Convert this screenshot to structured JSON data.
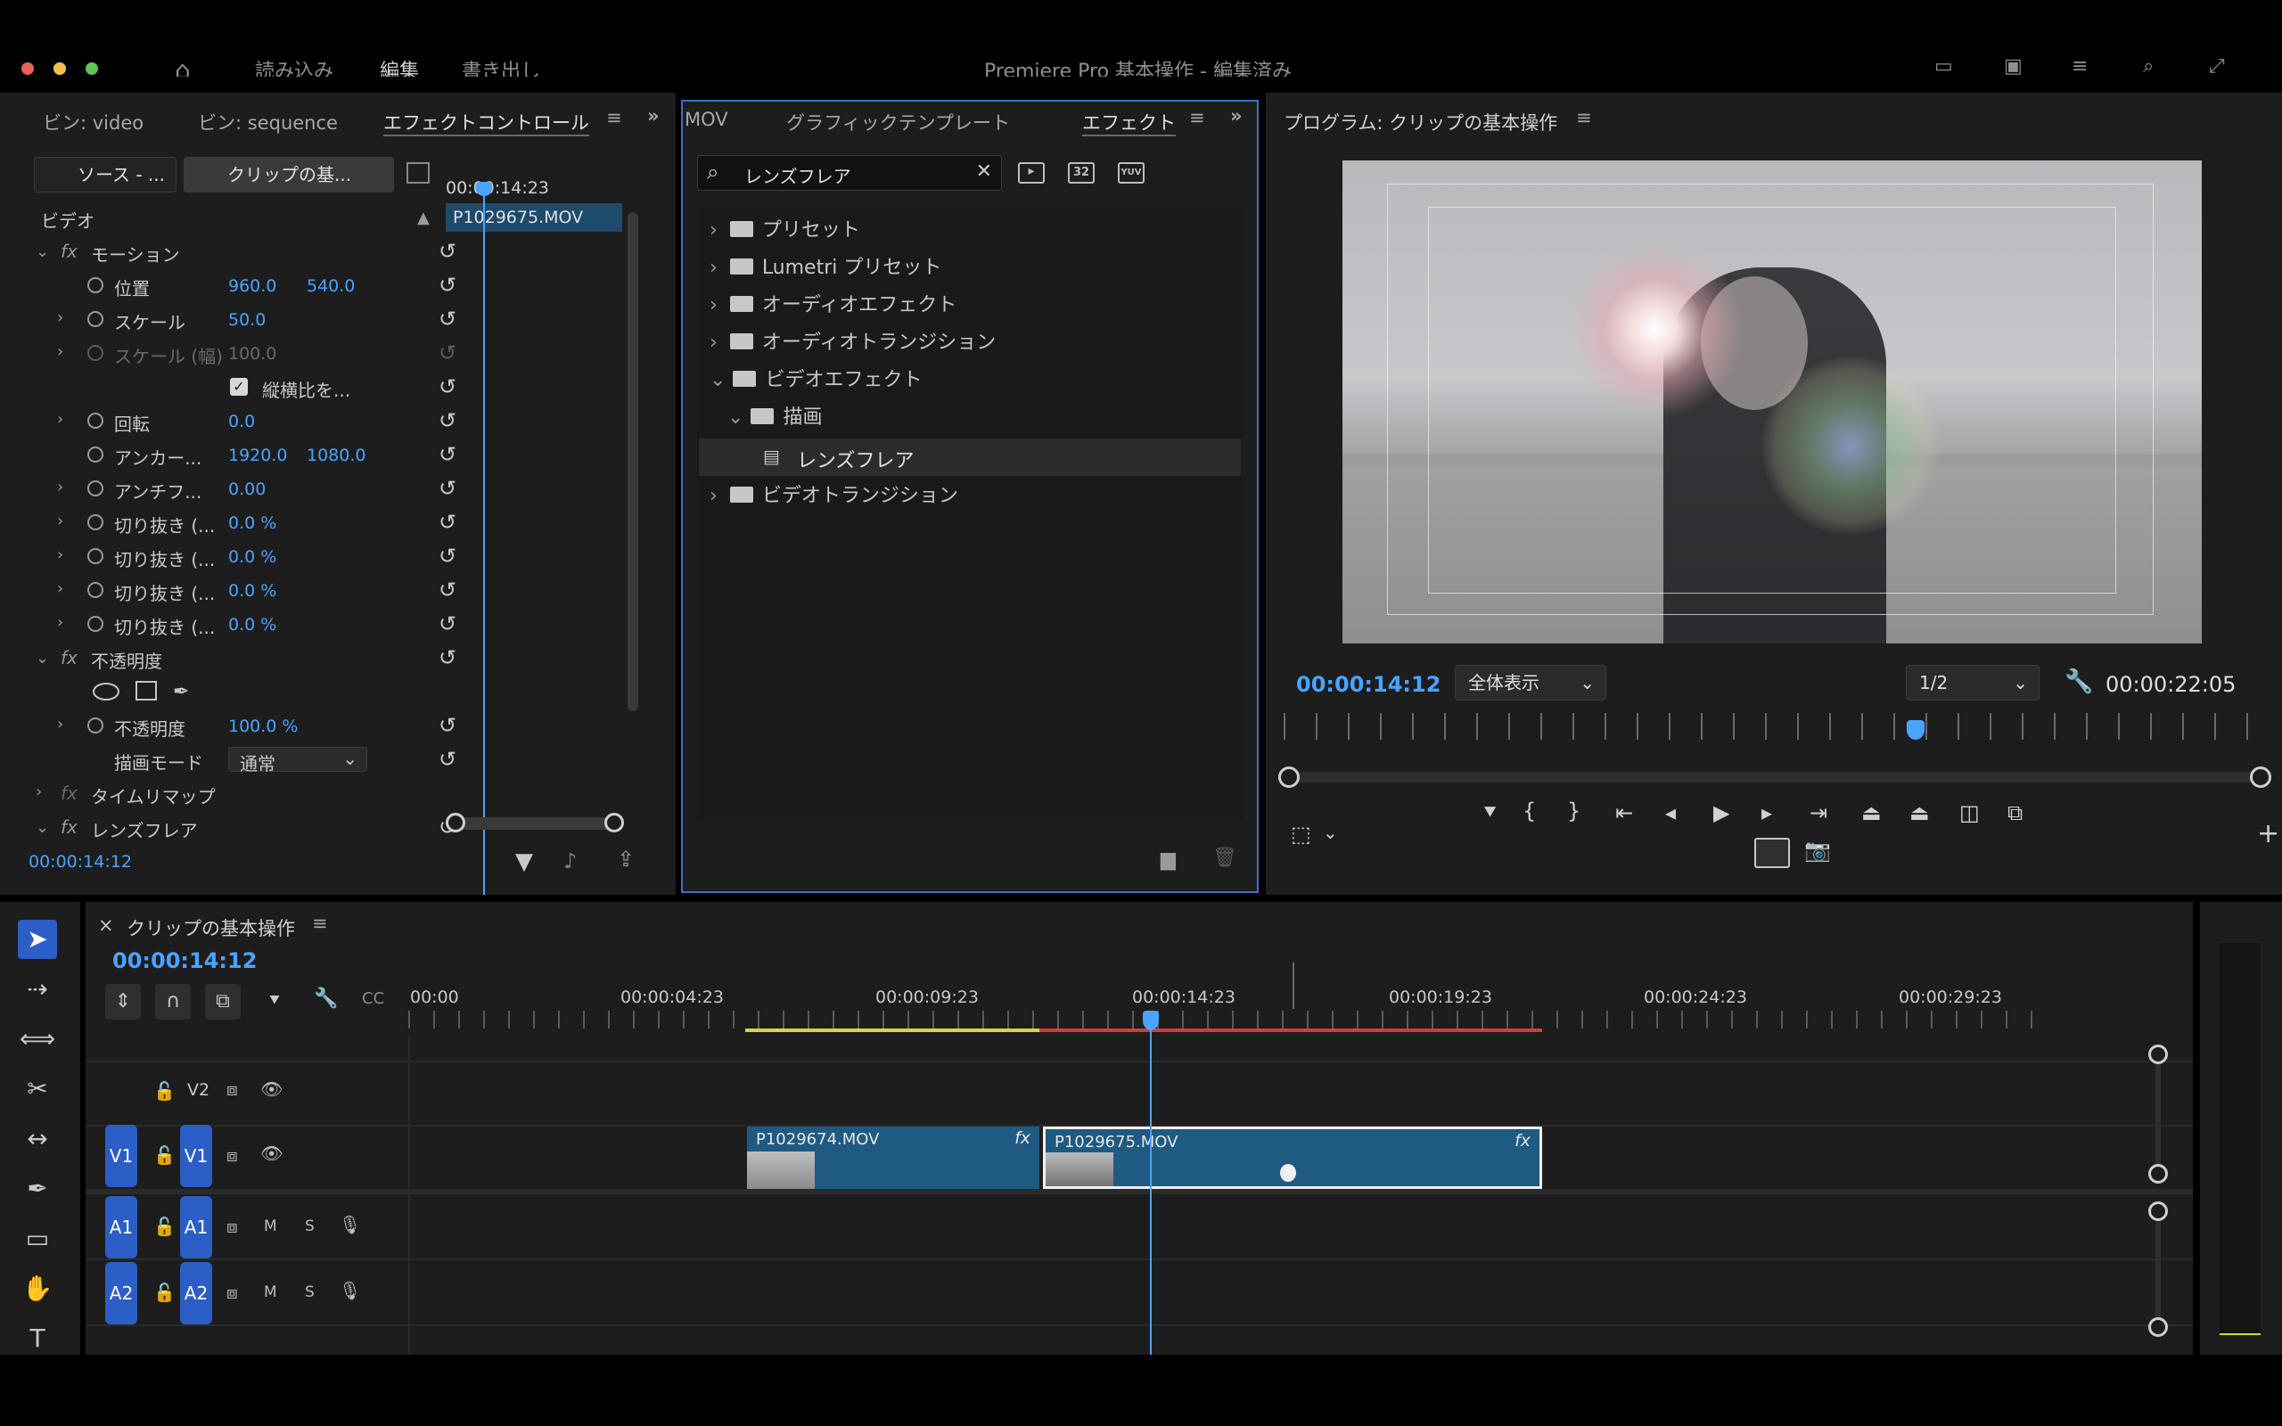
{
  "titlebar": {
    "app_title": "Premiere Pro 基本操作 - 編集済み",
    "workspace_tabs": [
      "読み込み",
      "編集",
      "書き出し"
    ]
  },
  "effect_controls": {
    "tabs": [
      "ビン: video",
      "ビン: sequence",
      "エフェクトコントロール"
    ],
    "source_dropdown": "ソース - ...",
    "clip_dropdown": "クリップの基...",
    "mini_timecode": "00:00:14:23",
    "clip_name": "P1029675.MOV",
    "section_video": "ビデオ",
    "motion": "モーション",
    "position": {
      "label": "位置",
      "x": "960.0",
      "y": "540.0"
    },
    "scale": {
      "label": "スケール",
      "value": "50.0"
    },
    "scale_width": {
      "label": "スケール (幅)",
      "value": "100.0"
    },
    "uniform_scale": "縦横比を...",
    "rotation": {
      "label": "回転",
      "value": "0.0"
    },
    "anchor": {
      "label": "アンカー...",
      "x": "1920.0",
      "y": "1080.0"
    },
    "antiflicker": {
      "label": "アンチフ...",
      "value": "0.00"
    },
    "crop": [
      {
        "label": "切り抜き (...",
        "value": "0.0 %"
      },
      {
        "label": "切り抜き (...",
        "value": "0.0 %"
      },
      {
        "label": "切り抜き (...",
        "value": "0.0 %"
      },
      {
        "label": "切り抜き (...",
        "value": "0.0 %"
      }
    ],
    "opacity_section": "不透明度",
    "opacity": {
      "label": "不透明度",
      "value": "100.0 %"
    },
    "blend_mode": {
      "label": "描画モード",
      "value": "通常"
    },
    "time_remap": "タイムリマップ",
    "lens_flare": "レンズフレア",
    "footer_timecode": "00:00:14:12"
  },
  "effects_panel": {
    "tabs": [
      "MOV",
      "グラフィックテンプレート",
      "エフェクト"
    ],
    "search_value": "レンズフレア",
    "badge_32": "32",
    "badge_yuv": "YUV",
    "tree": [
      {
        "label": "プリセット"
      },
      {
        "label": "Lumetri プリセット"
      },
      {
        "label": "オーディオエフェクト"
      },
      {
        "label": "オーディオトランジション"
      },
      {
        "label": "ビデオエフェクト"
      },
      {
        "label": "描画"
      },
      {
        "label": "レンズフレア"
      },
      {
        "label": "ビデオトランジション"
      }
    ]
  },
  "program_monitor": {
    "title": "プログラム: クリップの基本操作",
    "current_timecode": "00:00:14:12",
    "fit": "全体表示",
    "resolution": "1/2",
    "duration": "00:00:22:05"
  },
  "timeline": {
    "sequence_name": "クリップの基本操作",
    "timecode": "00:00:14:12",
    "ruler_labels": [
      "00:00",
      "00:00:04:23",
      "00:00:09:23",
      "00:00:14:23",
      "00:00:19:23",
      "00:00:24:23",
      "00:00:29:23"
    ],
    "tracks": [
      {
        "id": "V2",
        "toggle": ""
      },
      {
        "id": "V1",
        "toggle": "V1"
      },
      {
        "id": "A1",
        "toggle": "A1",
        "m": "M",
        "s": "S"
      },
      {
        "id": "A2",
        "toggle": "A2",
        "m": "M",
        "s": "S"
      }
    ],
    "clips": [
      {
        "name": "P1029674.MOV",
        "fx": "fx"
      },
      {
        "name": "P1029675.MOV",
        "fx": "fx"
      }
    ]
  },
  "colors": {
    "accent": "#4aa3ff",
    "panel": "#1d1d1d",
    "track_toggle": "#2c5ec7",
    "clip": "#1e5a82"
  }
}
